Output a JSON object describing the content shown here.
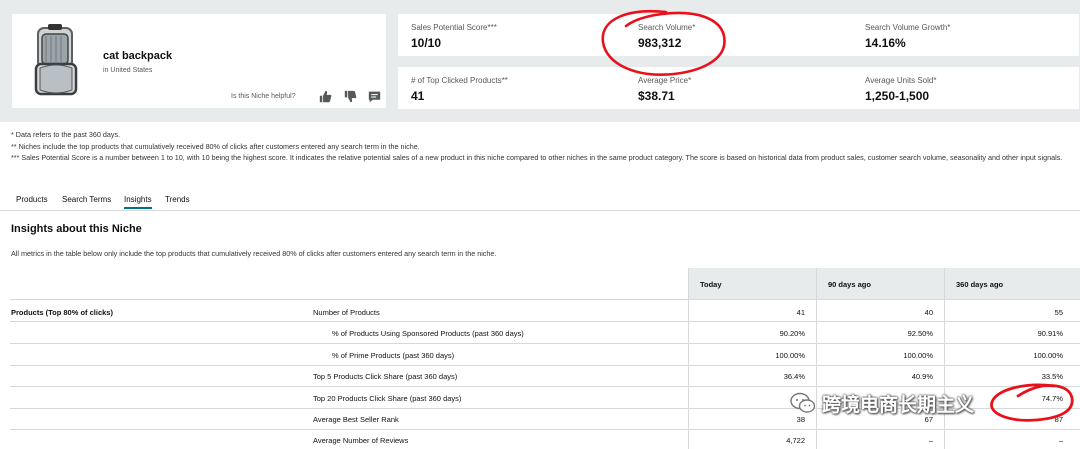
{
  "niche": {
    "title": "cat backpack",
    "subtitle": "in United States",
    "helpful_prompt": "Is this Niche helpful?"
  },
  "metrics": [
    {
      "label": "Sales Potential Score***",
      "value": "10/10"
    },
    {
      "label": "Search Volume*",
      "value": "983,312"
    },
    {
      "label": "Search Volume Growth*",
      "value": "14.16%"
    },
    {
      "label": "# of Top Clicked Products**",
      "value": "41"
    },
    {
      "label": "Average Price*",
      "value": "$38.71"
    },
    {
      "label": "Average Units Sold*",
      "value": "1,250-1,500"
    }
  ],
  "notes": [
    "* Data refers to the past 360 days.",
    "** Niches include the top products that cumulatively received 80% of clicks after customers entered any search term in the niche.",
    "*** Sales Potential Score is a number between 1 to 10, with 10 being the highest score. It indicates the relative potential sales of a new product in this niche compared to other niches in the same product category. The score is based on historical data from product sales, customer search volume, seasonality and other input signals."
  ],
  "tabs": [
    "Products",
    "Search Terms",
    "Insights",
    "Trends"
  ],
  "active_tab": "Insights",
  "insights": {
    "title": "Insights about this Niche",
    "description": "All metrics in the table below only include the top products that cumulatively received 80% of clicks after customers entered any search term in the niche.",
    "columns": [
      "Today",
      "90 days ago",
      "360 days ago"
    ],
    "group_label": "Products (Top 80% of clicks)",
    "rows": [
      {
        "name": "Number of Products",
        "values": [
          "41",
          "40",
          "55"
        ]
      },
      {
        "name": "% of Products Using Sponsored Products (past 360 days)",
        "values": [
          "90.20%",
          "92.50%",
          "90.91%"
        ]
      },
      {
        "name": "% of Prime Products (past 360 days)",
        "values": [
          "100.00%",
          "100.00%",
          "100.00%"
        ]
      },
      {
        "name": "Top 5 Products Click Share (past 360 days)",
        "values": [
          "36.4%",
          "40.9%",
          "33.5%"
        ]
      },
      {
        "name": "Top 20 Products Click Share (past 360 days)",
        "values": [
          "",
          "",
          "74.7%"
        ]
      },
      {
        "name": "Average Best Seller Rank",
        "values": [
          "38",
          "67",
          "87"
        ]
      },
      {
        "name": "Average Number of Reviews",
        "values": [
          "4,722",
          "–",
          "–"
        ]
      }
    ]
  },
  "watermark": "跨境电商长期主义",
  "colors": {
    "panel_bg": "#e8ebeb",
    "accent": "#007185",
    "annotation_red": "#e8101a"
  }
}
